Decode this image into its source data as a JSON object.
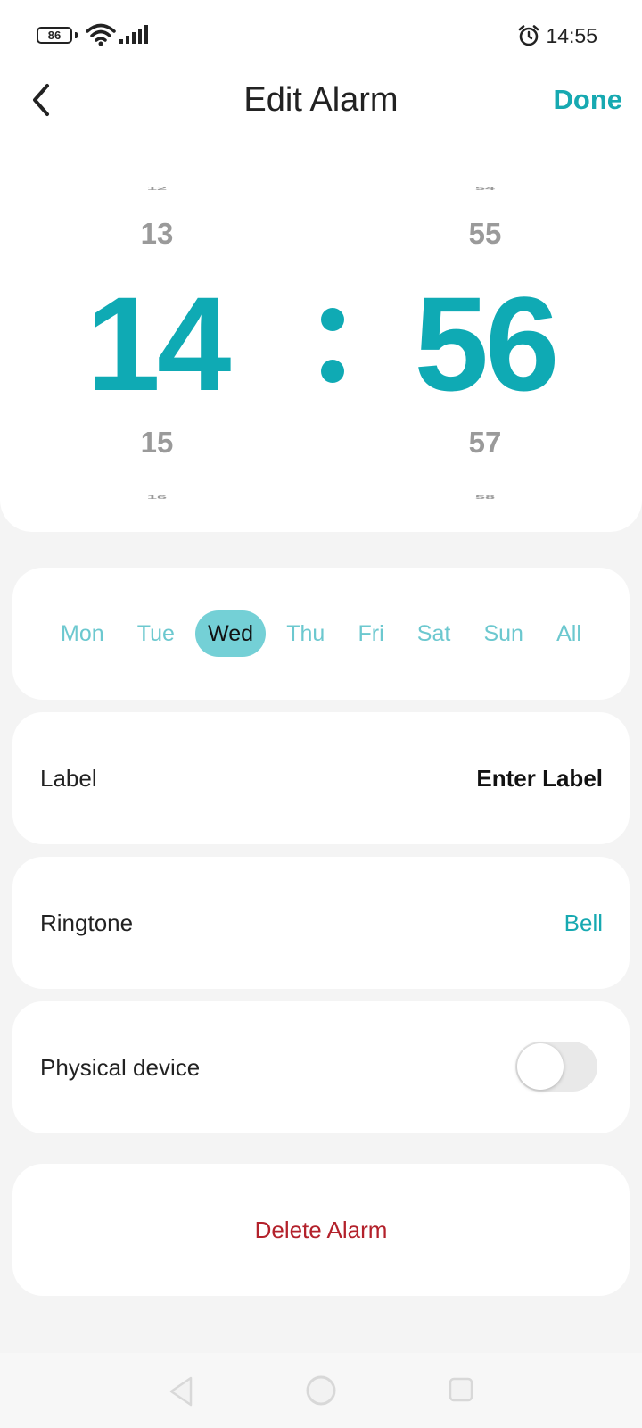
{
  "status_bar": {
    "battery_level": "86",
    "time": "14:55",
    "icons": [
      "battery-icon",
      "wifi-icon",
      "signal-icon",
      "alarm-clock-icon"
    ]
  },
  "header": {
    "title": "Edit Alarm",
    "done_label": "Done",
    "back_icon": "chevron-left-icon"
  },
  "picker": {
    "hours": {
      "far_above": "12",
      "above": "13",
      "selected": "14",
      "below": "15",
      "far_below": "16"
    },
    "separator": ":",
    "minutes": {
      "far_above": "54",
      "above": "55",
      "selected": "56",
      "below": "57",
      "far_below": "58"
    }
  },
  "days": {
    "items": [
      "Mon",
      "Tue",
      "Wed",
      "Thu",
      "Fri",
      "Sat",
      "Sun",
      "All"
    ],
    "selected": "Wed"
  },
  "label_row": {
    "label": "Label",
    "value": "Enter Label"
  },
  "ringtone_row": {
    "label": "Ringtone",
    "value": "Bell"
  },
  "device_row": {
    "label": "Physical device",
    "toggle_on": false
  },
  "delete": {
    "label": "Delete Alarm"
  },
  "colors": {
    "accent": "#0faab4",
    "day_active_bg": "#74d0d6",
    "delete_red": "#b3212b"
  },
  "nav_bar": {
    "icons": [
      "nav-back-icon",
      "nav-home-icon",
      "nav-recent-icon"
    ]
  }
}
